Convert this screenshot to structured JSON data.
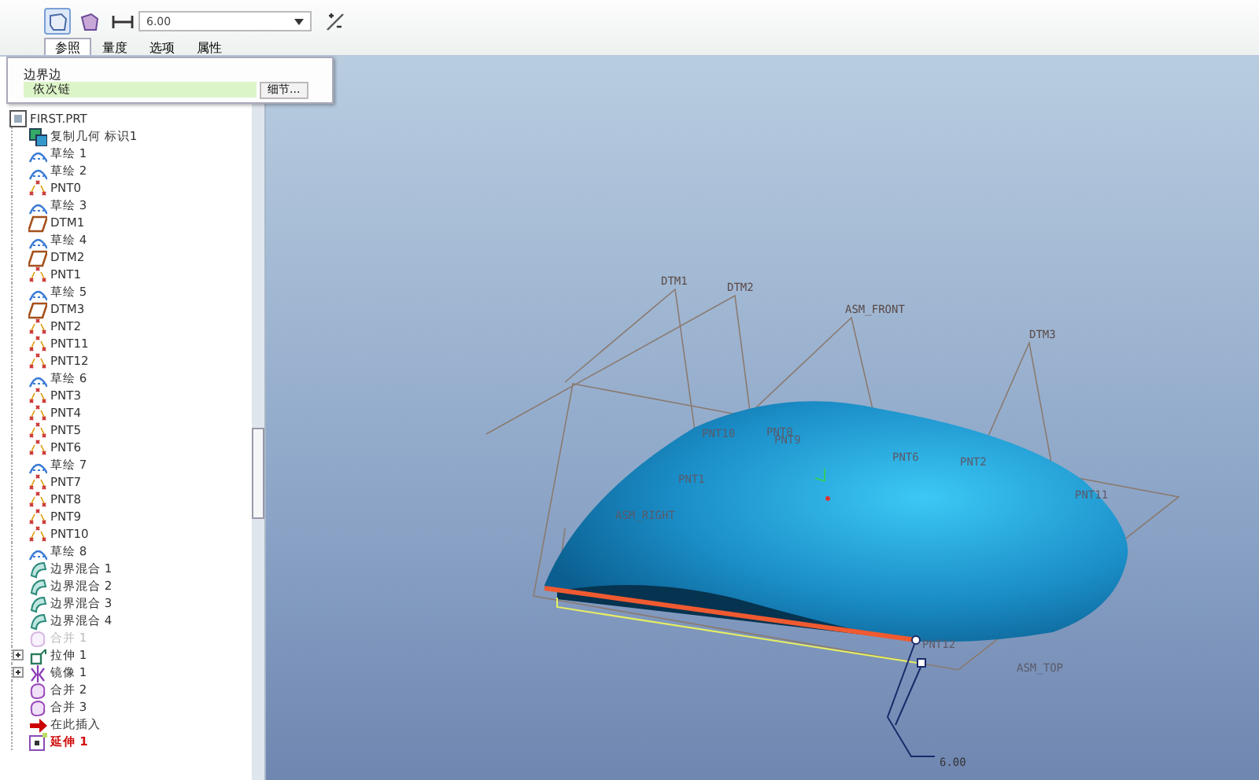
{
  "ribbon": {
    "depth_value": "6.00",
    "tabs": [
      {
        "label": "参照",
        "selected": true
      },
      {
        "label": "量度",
        "selected": false
      },
      {
        "label": "选项",
        "selected": false
      },
      {
        "label": "属性",
        "selected": false
      }
    ]
  },
  "panel": {
    "label": "边界边",
    "field_value": "依次链",
    "button": "细节..."
  },
  "tree": {
    "label": "FIRST.PRT",
    "kind": "part",
    "children": [
      {
        "label": "复制几何 标识1",
        "kind": "copygeom",
        "suppressed": false,
        "current": false
      },
      {
        "label": "草绘 1",
        "kind": "sketch",
        "suppressed": false,
        "current": false
      },
      {
        "label": "草绘 2",
        "kind": "sketch",
        "suppressed": false,
        "current": false
      },
      {
        "label": "PNT0",
        "kind": "point",
        "suppressed": false,
        "current": false
      },
      {
        "label": "草绘 3",
        "kind": "sketch",
        "suppressed": false,
        "current": false
      },
      {
        "label": "DTM1",
        "kind": "plane",
        "suppressed": false,
        "current": false
      },
      {
        "label": "草绘 4",
        "kind": "sketch",
        "suppressed": false,
        "current": false
      },
      {
        "label": "DTM2",
        "kind": "plane",
        "suppressed": false,
        "current": false
      },
      {
        "label": "PNT1",
        "kind": "point",
        "suppressed": false,
        "current": false
      },
      {
        "label": "草绘 5",
        "kind": "sketch",
        "suppressed": false,
        "current": false
      },
      {
        "label": "DTM3",
        "kind": "plane",
        "suppressed": false,
        "current": false
      },
      {
        "label": "PNT2",
        "kind": "point",
        "suppressed": false,
        "current": false
      },
      {
        "label": "PNT11",
        "kind": "point",
        "suppressed": false,
        "current": false
      },
      {
        "label": "PNT12",
        "kind": "point",
        "suppressed": false,
        "current": false
      },
      {
        "label": "草绘 6",
        "kind": "sketch",
        "suppressed": false,
        "current": false
      },
      {
        "label": "PNT3",
        "kind": "point",
        "suppressed": false,
        "current": false
      },
      {
        "label": "PNT4",
        "kind": "point",
        "suppressed": false,
        "current": false
      },
      {
        "label": "PNT5",
        "kind": "point",
        "suppressed": false,
        "current": false
      },
      {
        "label": "PNT6",
        "kind": "point",
        "suppressed": false,
        "current": false
      },
      {
        "label": "草绘 7",
        "kind": "sketch",
        "suppressed": false,
        "current": false
      },
      {
        "label": "PNT7",
        "kind": "point",
        "suppressed": false,
        "current": false
      },
      {
        "label": "PNT8",
        "kind": "point",
        "suppressed": false,
        "current": false
      },
      {
        "label": "PNT9",
        "kind": "point",
        "suppressed": false,
        "current": false
      },
      {
        "label": "PNT10",
        "kind": "point",
        "suppressed": false,
        "current": false
      },
      {
        "label": "草绘 8",
        "kind": "sketch",
        "suppressed": false,
        "current": false
      },
      {
        "label": "边界混合 1",
        "kind": "blend",
        "suppressed": false,
        "current": false
      },
      {
        "label": "边界混合 2",
        "kind": "blend",
        "suppressed": false,
        "current": false
      },
      {
        "label": "边界混合 3",
        "kind": "blend",
        "suppressed": false,
        "current": false
      },
      {
        "label": "边界混合 4",
        "kind": "blend",
        "suppressed": false,
        "current": false
      },
      {
        "label": "合并 1",
        "kind": "merge",
        "suppressed": true,
        "current": false
      },
      {
        "label": "拉伸 1",
        "kind": "extrude",
        "suppressed": false,
        "current": false,
        "expanded": false
      },
      {
        "label": "镜像 1",
        "kind": "mirror",
        "suppressed": false,
        "current": false,
        "expanded": false
      },
      {
        "label": "合并 2",
        "kind": "merge",
        "suppressed": false,
        "current": false
      },
      {
        "label": "合并 3",
        "kind": "merge",
        "suppressed": false,
        "current": false
      },
      {
        "label": "在此插入",
        "kind": "insert",
        "suppressed": false,
        "current": false
      },
      {
        "label": "延伸 1",
        "kind": "extend",
        "suppressed": false,
        "current": true
      }
    ]
  },
  "viewport": {
    "labels": [
      "DTM1",
      "DTM2",
      "ASM_FRONT",
      "DTM3",
      "PNT10",
      "PNT9",
      "PNT0",
      "PNT1",
      "PNT6",
      "PNT2",
      "PNT11",
      "ASM_RIGHT",
      "PNT12",
      "ASM_TOP"
    ],
    "dimension": "6.00"
  }
}
